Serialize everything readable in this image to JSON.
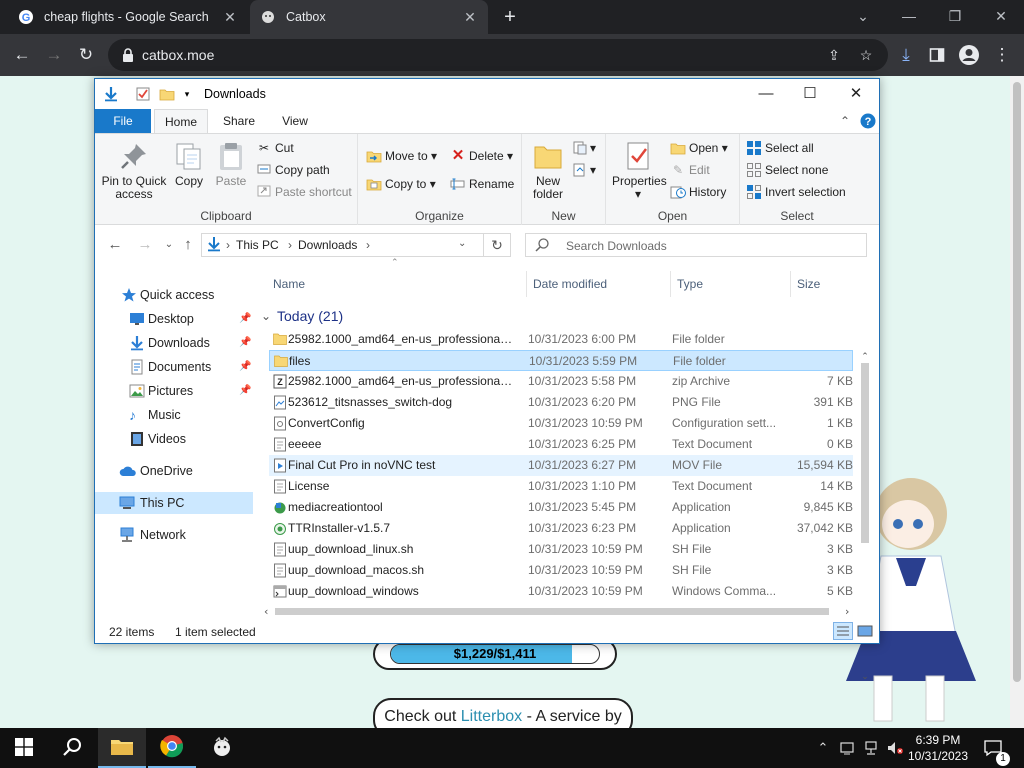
{
  "browser": {
    "tabs": [
      {
        "title": "cheap flights - Google Search",
        "favicon": "google-icon"
      },
      {
        "title": "Catbox",
        "favicon": "catbox-icon"
      }
    ],
    "url": "catbox.moe"
  },
  "webpage": {
    "storage_text": "$1,229/$1,411",
    "storage_fraction": 0.871,
    "checkout_prefix": "Check out ",
    "checkout_link": "Litterbox",
    "checkout_suffix": " - A service by"
  },
  "explorer": {
    "title": "Downloads",
    "ribbon_tabs": {
      "file": "File",
      "home": "Home",
      "share": "Share",
      "view": "View"
    },
    "clipboard": {
      "pin": "Pin to Quick access",
      "copy": "Copy",
      "paste": "Paste",
      "cut": "Cut",
      "copy_path": "Copy path",
      "paste_shortcut": "Paste shortcut",
      "label": "Clipboard"
    },
    "organize": {
      "move_to": "Move to",
      "copy_to": "Copy to",
      "delete": "Delete",
      "rename": "Rename",
      "label": "Organize"
    },
    "new": {
      "new_folder": "New folder",
      "label": "New"
    },
    "open": {
      "properties": "Properties",
      "open": "Open",
      "edit": "Edit",
      "history": "History",
      "label": "Open"
    },
    "select": {
      "select_all": "Select all",
      "select_none": "Select none",
      "invert": "Invert selection",
      "label": "Select"
    },
    "breadcrumb": {
      "pc": "This PC",
      "folder": "Downloads"
    },
    "search_placeholder": "Search Downloads",
    "nav": {
      "quick_access": "Quick access",
      "desktop": "Desktop",
      "downloads": "Downloads",
      "documents": "Documents",
      "pictures": "Pictures",
      "music": "Music",
      "videos": "Videos",
      "onedrive": "OneDrive",
      "this_pc": "This PC",
      "network": "Network"
    },
    "columns": {
      "name": "Name",
      "date": "Date modified",
      "type": "Type",
      "size": "Size"
    },
    "group": "Today (21)",
    "files": [
      {
        "name": "25982.1000_amd64_en-us_professional_7...",
        "date": "10/31/2023 6:00 PM",
        "type": "File folder",
        "size": "",
        "icon": "folder"
      },
      {
        "name": "files",
        "date": "10/31/2023 5:59 PM",
        "type": "File folder",
        "size": "",
        "icon": "folder"
      },
      {
        "name": "25982.1000_amd64_en-us_professional_7...",
        "date": "10/31/2023 5:58 PM",
        "type": "zip Archive",
        "size": "7 KB",
        "icon": "zip"
      },
      {
        "name": "523612_titsnasses_switch-dog",
        "date": "10/31/2023 6:20 PM",
        "type": "PNG File",
        "size": "391 KB",
        "icon": "image"
      },
      {
        "name": "ConvertConfig",
        "date": "10/31/2023 10:59 PM",
        "type": "Configuration sett...",
        "size": "1 KB",
        "icon": "config"
      },
      {
        "name": "eeeee",
        "date": "10/31/2023 6:25 PM",
        "type": "Text Document",
        "size": "0 KB",
        "icon": "text"
      },
      {
        "name": "Final Cut Pro in noVNC test",
        "date": "10/31/2023 6:27 PM",
        "type": "MOV File",
        "size": "15,594 KB",
        "icon": "video"
      },
      {
        "name": "License",
        "date": "10/31/2023 1:10 PM",
        "type": "Text Document",
        "size": "14 KB",
        "icon": "text"
      },
      {
        "name": "mediacreationtool",
        "date": "10/31/2023 5:45 PM",
        "type": "Application",
        "size": "9,845 KB",
        "icon": "app"
      },
      {
        "name": "TTRInstaller-v1.5.7",
        "date": "10/31/2023 6:23 PM",
        "type": "Application",
        "size": "37,042 KB",
        "icon": "app2"
      },
      {
        "name": "uup_download_linux.sh",
        "date": "10/31/2023 10:59 PM",
        "type": "SH File",
        "size": "3 KB",
        "icon": "text"
      },
      {
        "name": "uup_download_macos.sh",
        "date": "10/31/2023 10:59 PM",
        "type": "SH File",
        "size": "3 KB",
        "icon": "text"
      },
      {
        "name": "uup_download_windows",
        "date": "10/31/2023 10:59 PM",
        "type": "Windows Comma...",
        "size": "5 KB",
        "icon": "cmd"
      }
    ],
    "status_items": "22 items",
    "status_selected": "1 item selected"
  },
  "taskbar": {
    "time": "6:39 PM",
    "date": "10/31/2023",
    "notifications": "1"
  },
  "colors": {
    "accent": "#1979ca",
    "selection": "#cce8ff",
    "folder": "#f8d775",
    "taskbar": "#101010"
  }
}
